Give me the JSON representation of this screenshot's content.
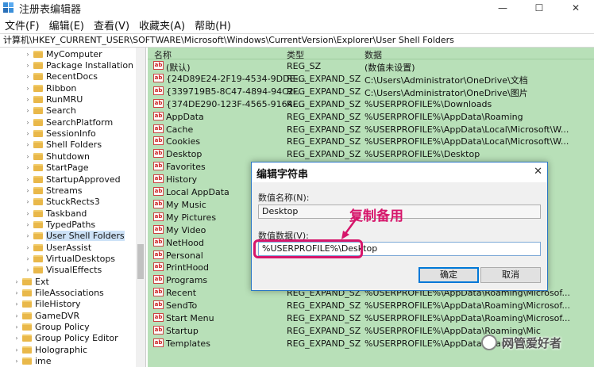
{
  "window": {
    "title": "注册表编辑器",
    "minimize": "—",
    "maximize": "☐",
    "close": "✕"
  },
  "menu": [
    "文件(F)",
    "编辑(E)",
    "查看(V)",
    "收藏夹(A)",
    "帮助(H)"
  ],
  "address": "计算机\\HKEY_CURRENT_USER\\SOFTWARE\\Microsoft\\Windows\\CurrentVersion\\Explorer\\User Shell Folders",
  "tree": [
    {
      "label": "MyComputer",
      "level": 1,
      "selected": false
    },
    {
      "label": "Package Installation",
      "level": 1,
      "selected": false
    },
    {
      "label": "RecentDocs",
      "level": 1,
      "selected": false
    },
    {
      "label": "Ribbon",
      "level": 1,
      "selected": false
    },
    {
      "label": "RunMRU",
      "level": 1,
      "selected": false
    },
    {
      "label": "Search",
      "level": 1,
      "selected": false
    },
    {
      "label": "SearchPlatform",
      "level": 1,
      "selected": false
    },
    {
      "label": "SessionInfo",
      "level": 1,
      "selected": false
    },
    {
      "label": "Shell Folders",
      "level": 1,
      "selected": false
    },
    {
      "label": "Shutdown",
      "level": 1,
      "selected": false
    },
    {
      "label": "StartPage",
      "level": 1,
      "selected": false
    },
    {
      "label": "StartupApproved",
      "level": 1,
      "selected": false
    },
    {
      "label": "Streams",
      "level": 1,
      "selected": false
    },
    {
      "label": "StuckRects3",
      "level": 1,
      "selected": false
    },
    {
      "label": "Taskband",
      "level": 1,
      "selected": false
    },
    {
      "label": "TypedPaths",
      "level": 1,
      "selected": false
    },
    {
      "label": "User Shell Folders",
      "level": 1,
      "selected": true
    },
    {
      "label": "UserAssist",
      "level": 1,
      "selected": false
    },
    {
      "label": "VirtualDesktops",
      "level": 1,
      "selected": false
    },
    {
      "label": "VisualEffects",
      "level": 1,
      "selected": false
    },
    {
      "label": "Ext",
      "level": 0,
      "selected": false
    },
    {
      "label": "FileAssociations",
      "level": 0,
      "selected": false
    },
    {
      "label": "FileHistory",
      "level": 0,
      "selected": false
    },
    {
      "label": "GameDVR",
      "level": 0,
      "selected": false
    },
    {
      "label": "Group Policy",
      "level": 0,
      "selected": false
    },
    {
      "label": "Group Policy Editor",
      "level": 0,
      "selected": false
    },
    {
      "label": "Holographic",
      "level": 0,
      "selected": false
    },
    {
      "label": "ime",
      "level": 0,
      "selected": false
    }
  ],
  "list": {
    "headers": [
      "名称",
      "类型",
      "数据"
    ],
    "rows": [
      {
        "name": "(默认)",
        "type": "REG_SZ",
        "data": "(数值未设置)"
      },
      {
        "name": "{24D89E24-2F19-4534-9DDE-...",
        "type": "REG_EXPAND_SZ",
        "data": "C:\\Users\\Administrator\\OneDrive\\文档"
      },
      {
        "name": "{339719B5-8C47-4894-94C2-...",
        "type": "REG_EXPAND_SZ",
        "data": "C:\\Users\\Administrator\\OneDrive\\图片"
      },
      {
        "name": "{374DE290-123F-4565-9164-...",
        "type": "REG_EXPAND_SZ",
        "data": "%USERPROFILE%\\Downloads"
      },
      {
        "name": "AppData",
        "type": "REG_EXPAND_SZ",
        "data": "%USERPROFILE%\\AppData\\Roaming"
      },
      {
        "name": "Cache",
        "type": "REG_EXPAND_SZ",
        "data": "%USERPROFILE%\\AppData\\Local\\Microsoft\\W..."
      },
      {
        "name": "Cookies",
        "type": "REG_EXPAND_SZ",
        "data": "%USERPROFILE%\\AppData\\Local\\Microsoft\\W..."
      },
      {
        "name": "Desktop",
        "type": "REG_EXPAND_SZ",
        "data": "%USERPROFILE%\\Desktop"
      },
      {
        "name": "Favorites",
        "type": "",
        "data": ""
      },
      {
        "name": "History",
        "type": "",
        "data": ""
      },
      {
        "name": "Local AppData",
        "type": "",
        "data": ""
      },
      {
        "name": "My Music",
        "type": "",
        "data": ""
      },
      {
        "name": "My Pictures",
        "type": "",
        "data": ""
      },
      {
        "name": "My Video",
        "type": "",
        "data": ""
      },
      {
        "name": "NetHood",
        "type": "",
        "data": ""
      },
      {
        "name": "Personal",
        "type": "",
        "data": ""
      },
      {
        "name": "PrintHood",
        "type": "",
        "data": ""
      },
      {
        "name": "Programs",
        "type": "",
        "data": ""
      },
      {
        "name": "Recent",
        "type": "REG_EXPAND_SZ",
        "data": "%USERPROFILE%\\AppData\\Roaming\\Microsof..."
      },
      {
        "name": "SendTo",
        "type": "REG_EXPAND_SZ",
        "data": "%USERPROFILE%\\AppData\\Roaming\\Microsof..."
      },
      {
        "name": "Start Menu",
        "type": "REG_EXPAND_SZ",
        "data": "%USERPROFILE%\\AppData\\Roaming\\Microsof..."
      },
      {
        "name": "Startup",
        "type": "REG_EXPAND_SZ",
        "data": "%USERPROFILE%\\AppData\\Roaming\\Mic"
      },
      {
        "name": "Templates",
        "type": "REG_EXPAND_SZ",
        "data": "%USERPROFILE%\\AppData\\Roaming\\Ro"
      }
    ]
  },
  "dialog": {
    "title": "编辑字符串",
    "close": "✕",
    "name_label": "数值名称(N):",
    "name_value": "Desktop",
    "data_label": "数值数据(V):",
    "data_value": "%USERPROFILE%\\Desktop",
    "ok": "确定",
    "cancel": "取消"
  },
  "annotation": "复制备用",
  "watermark": "网管爱好者",
  "colors": {
    "list_background": "#b8e0b8",
    "annotation": "#d6166b",
    "dialog_border": "#2b78c5"
  }
}
